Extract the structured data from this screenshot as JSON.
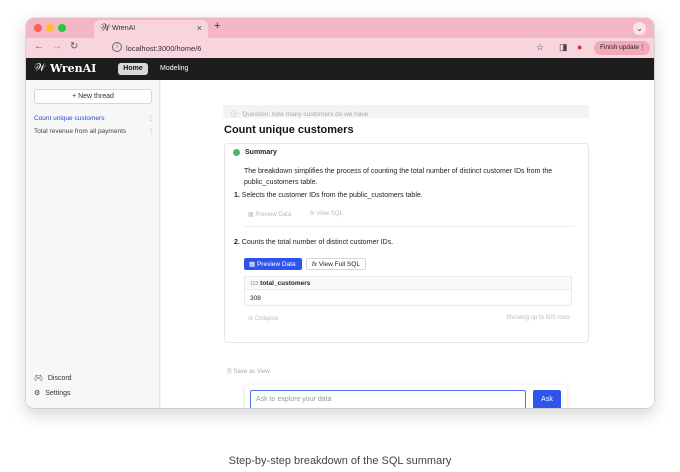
{
  "browser": {
    "tab_title": "WrenAI",
    "tab_close": "×",
    "new_tab": "+",
    "url": "localhost:3000/home/6",
    "finish_update_label": "Finish update",
    "colors": {
      "tabstrip": "#f3b7c4",
      "addrbar": "#f8d5dd"
    }
  },
  "header": {
    "logo_text": "WrenAI",
    "nav": {
      "home_label": "Home",
      "modeling_label": "Modeling"
    }
  },
  "sidebar": {
    "new_thread_label": "+ New thread",
    "threads": [
      {
        "label": "Count unique customers",
        "active": true
      },
      {
        "label": "Total revenue from all payments",
        "active": false
      }
    ],
    "more_glyph": "⋮",
    "discord_label": "Discord",
    "settings_label": "Settings"
  },
  "main": {
    "question": "Question: how many customers do we have",
    "answer_title": "Count unique customers",
    "summary_label": "Summary",
    "summary_text": "The breakdown simplifies the process of counting the total number of distinct customer IDs from the public_customers table.",
    "steps": [
      {
        "number": "1.",
        "text": "Selects the customer IDs from the public_customers table.",
        "preview_label": "Preview Data",
        "sql_label": "View SQL"
      },
      {
        "number": "2.",
        "text": "Counts the total number of distinct customer IDs.",
        "preview_label": "Preview Data",
        "sql_label": "View Full SQL"
      }
    ],
    "result_table": {
      "column_type": "123",
      "column": "total_customers",
      "value": "308"
    },
    "collapse_label": "Collapse",
    "showing_label": "Showing up to 500 rows",
    "save_view_label": "Save as View",
    "ask_placeholder": "Ask to explore your data",
    "ask_button": "Ask",
    "accent_color": "#2f54eb"
  },
  "caption": "Step-by-step breakdown of the SQL summary"
}
